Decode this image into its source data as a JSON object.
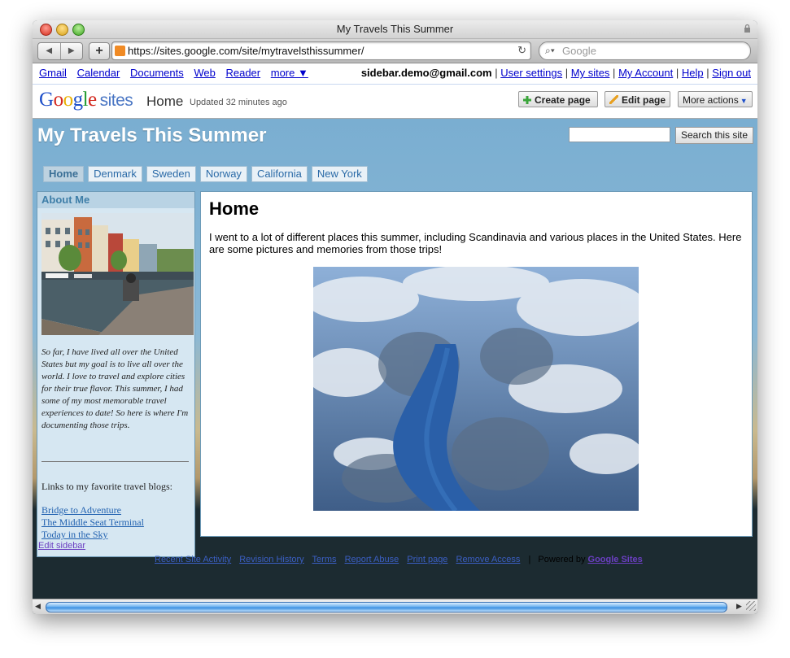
{
  "window": {
    "title": "My Travels This Summer"
  },
  "browser": {
    "url": "https://sites.google.com/site/mytravelsthissummer/",
    "search_placeholder": "Google",
    "back": "◀",
    "forward": "▶",
    "new_tab": "+"
  },
  "gbar": {
    "links": [
      "Gmail",
      "Calendar",
      "Documents",
      "Web",
      "Reader",
      "more ▼"
    ],
    "email": "sidebar.demo@gmail.com",
    "right_links": [
      "User settings",
      "My sites",
      "My Account",
      "Help",
      "Sign out"
    ],
    "separator": "|"
  },
  "sites_header": {
    "logo_word": "Google",
    "logo_sites": "sites",
    "page_name": "Home",
    "updated": "Updated 32 minutes ago",
    "create_page": "Create page",
    "edit_page": "Edit page",
    "more_actions": "More actions"
  },
  "site": {
    "title": "My Travels This Summer",
    "search_button": "Search this site",
    "tabs": [
      {
        "label": "Home",
        "active": true
      },
      {
        "label": "Denmark",
        "active": false
      },
      {
        "label": "Sweden",
        "active": false
      },
      {
        "label": "Norway",
        "active": false
      },
      {
        "label": "California",
        "active": false
      },
      {
        "label": "New York",
        "active": false
      }
    ]
  },
  "sidebar": {
    "title": "About Me",
    "bio": "So far, I have lived all over the United States but my goal is to live all over the world. I love to travel and explore cities for their true flavor. This summer, I had some of my most memorable travel experiences to date! So here is where I'm documenting those trips.",
    "links_title": "Links to my favorite travel blogs:",
    "links": [
      "Bridge to Adventure",
      "The Middle Seat Terminal",
      "Today in the Sky"
    ]
  },
  "main": {
    "title": "Home",
    "text": "I went to a lot of different places this summer, including Scandinavia and various places in the United States. Here are some pictures and memories from those trips!"
  },
  "footer": {
    "edit_sidebar": "Edit sidebar",
    "links": [
      "Recent Site Activity",
      "Revision History",
      "Terms",
      "Report Abuse",
      "Print page",
      "Remove Access"
    ],
    "separator": "|",
    "powered_by": "Powered by",
    "google_sites": "Google Sites"
  },
  "colors": {
    "site_header_blue": "#7aaed1",
    "tab_text": "#2a6aa7",
    "sidebar_bg": "#d6e7f2",
    "dark_bg": "#1c2b31"
  }
}
